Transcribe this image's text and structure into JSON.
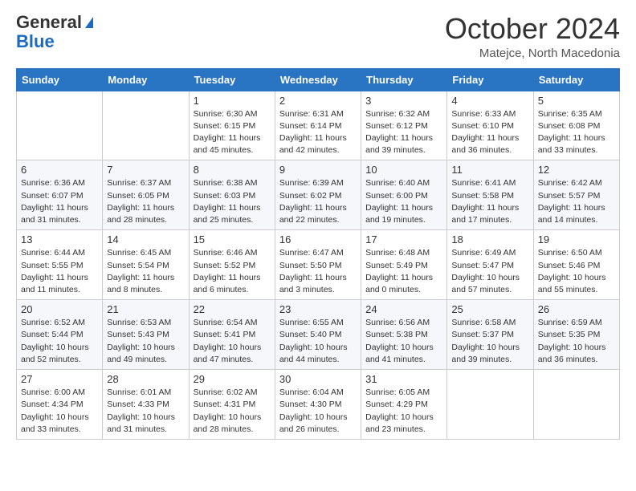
{
  "logo": {
    "general": "General",
    "blue": "Blue"
  },
  "title": "October 2024",
  "subtitle": "Matejce, North Macedonia",
  "weekdays": [
    "Sunday",
    "Monday",
    "Tuesday",
    "Wednesday",
    "Thursday",
    "Friday",
    "Saturday"
  ],
  "rows": [
    [
      {
        "day": "",
        "info": ""
      },
      {
        "day": "",
        "info": ""
      },
      {
        "day": "1",
        "info": "Sunrise: 6:30 AM\nSunset: 6:15 PM\nDaylight: 11 hours and 45 minutes."
      },
      {
        "day": "2",
        "info": "Sunrise: 6:31 AM\nSunset: 6:14 PM\nDaylight: 11 hours and 42 minutes."
      },
      {
        "day": "3",
        "info": "Sunrise: 6:32 AM\nSunset: 6:12 PM\nDaylight: 11 hours and 39 minutes."
      },
      {
        "day": "4",
        "info": "Sunrise: 6:33 AM\nSunset: 6:10 PM\nDaylight: 11 hours and 36 minutes."
      },
      {
        "day": "5",
        "info": "Sunrise: 6:35 AM\nSunset: 6:08 PM\nDaylight: 11 hours and 33 minutes."
      }
    ],
    [
      {
        "day": "6",
        "info": "Sunrise: 6:36 AM\nSunset: 6:07 PM\nDaylight: 11 hours and 31 minutes."
      },
      {
        "day": "7",
        "info": "Sunrise: 6:37 AM\nSunset: 6:05 PM\nDaylight: 11 hours and 28 minutes."
      },
      {
        "day": "8",
        "info": "Sunrise: 6:38 AM\nSunset: 6:03 PM\nDaylight: 11 hours and 25 minutes."
      },
      {
        "day": "9",
        "info": "Sunrise: 6:39 AM\nSunset: 6:02 PM\nDaylight: 11 hours and 22 minutes."
      },
      {
        "day": "10",
        "info": "Sunrise: 6:40 AM\nSunset: 6:00 PM\nDaylight: 11 hours and 19 minutes."
      },
      {
        "day": "11",
        "info": "Sunrise: 6:41 AM\nSunset: 5:58 PM\nDaylight: 11 hours and 17 minutes."
      },
      {
        "day": "12",
        "info": "Sunrise: 6:42 AM\nSunset: 5:57 PM\nDaylight: 11 hours and 14 minutes."
      }
    ],
    [
      {
        "day": "13",
        "info": "Sunrise: 6:44 AM\nSunset: 5:55 PM\nDaylight: 11 hours and 11 minutes."
      },
      {
        "day": "14",
        "info": "Sunrise: 6:45 AM\nSunset: 5:54 PM\nDaylight: 11 hours and 8 minutes."
      },
      {
        "day": "15",
        "info": "Sunrise: 6:46 AM\nSunset: 5:52 PM\nDaylight: 11 hours and 6 minutes."
      },
      {
        "day": "16",
        "info": "Sunrise: 6:47 AM\nSunset: 5:50 PM\nDaylight: 11 hours and 3 minutes."
      },
      {
        "day": "17",
        "info": "Sunrise: 6:48 AM\nSunset: 5:49 PM\nDaylight: 11 hours and 0 minutes."
      },
      {
        "day": "18",
        "info": "Sunrise: 6:49 AM\nSunset: 5:47 PM\nDaylight: 10 hours and 57 minutes."
      },
      {
        "day": "19",
        "info": "Sunrise: 6:50 AM\nSunset: 5:46 PM\nDaylight: 10 hours and 55 minutes."
      }
    ],
    [
      {
        "day": "20",
        "info": "Sunrise: 6:52 AM\nSunset: 5:44 PM\nDaylight: 10 hours and 52 minutes."
      },
      {
        "day": "21",
        "info": "Sunrise: 6:53 AM\nSunset: 5:43 PM\nDaylight: 10 hours and 49 minutes."
      },
      {
        "day": "22",
        "info": "Sunrise: 6:54 AM\nSunset: 5:41 PM\nDaylight: 10 hours and 47 minutes."
      },
      {
        "day": "23",
        "info": "Sunrise: 6:55 AM\nSunset: 5:40 PM\nDaylight: 10 hours and 44 minutes."
      },
      {
        "day": "24",
        "info": "Sunrise: 6:56 AM\nSunset: 5:38 PM\nDaylight: 10 hours and 41 minutes."
      },
      {
        "day": "25",
        "info": "Sunrise: 6:58 AM\nSunset: 5:37 PM\nDaylight: 10 hours and 39 minutes."
      },
      {
        "day": "26",
        "info": "Sunrise: 6:59 AM\nSunset: 5:35 PM\nDaylight: 10 hours and 36 minutes."
      }
    ],
    [
      {
        "day": "27",
        "info": "Sunrise: 6:00 AM\nSunset: 4:34 PM\nDaylight: 10 hours and 33 minutes."
      },
      {
        "day": "28",
        "info": "Sunrise: 6:01 AM\nSunset: 4:33 PM\nDaylight: 10 hours and 31 minutes."
      },
      {
        "day": "29",
        "info": "Sunrise: 6:02 AM\nSunset: 4:31 PM\nDaylight: 10 hours and 28 minutes."
      },
      {
        "day": "30",
        "info": "Sunrise: 6:04 AM\nSunset: 4:30 PM\nDaylight: 10 hours and 26 minutes."
      },
      {
        "day": "31",
        "info": "Sunrise: 6:05 AM\nSunset: 4:29 PM\nDaylight: 10 hours and 23 minutes."
      },
      {
        "day": "",
        "info": ""
      },
      {
        "day": "",
        "info": ""
      }
    ]
  ]
}
